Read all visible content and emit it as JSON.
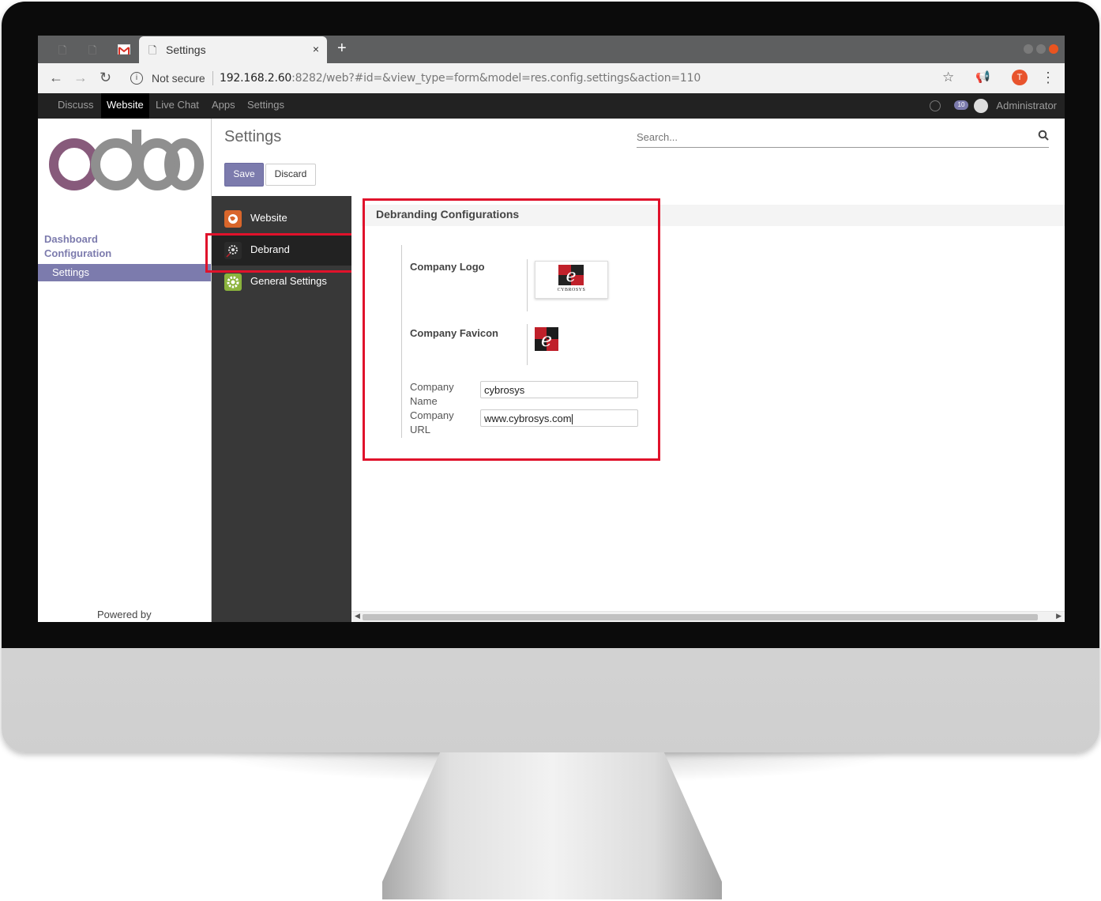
{
  "browser": {
    "tab_title": "Settings",
    "tab_close": "×",
    "new_tab": "+",
    "not_secure": "Not secure",
    "url_host": "192.168.2.60",
    "url_rest": ":8282/web?#id=&view_type=form&model=res.config.settings&action=110",
    "profile_initial": "T"
  },
  "topmenu": {
    "items": [
      "Discuss",
      "Website",
      "Live Chat",
      "Apps",
      "Settings"
    ],
    "active": "Website",
    "message_count": "10",
    "user": "Administrator"
  },
  "sidebar": {
    "logo_text": "odoo",
    "links": [
      "Dashboard",
      "Configuration"
    ],
    "active_item": "Settings",
    "powered_by": "Powered by"
  },
  "control_panel": {
    "title": "Settings",
    "search_placeholder": "Search...",
    "save_label": "Save",
    "discard_label": "Discard"
  },
  "settings_nav": {
    "items": [
      {
        "label": "Website",
        "icon": "globe-icon",
        "color": "#d9662b"
      },
      {
        "label": "Debrand",
        "icon": "debrand-gear-icon",
        "color": "#2b2b2b"
      },
      {
        "label": "General Settings",
        "icon": "gear-icon",
        "color": "#8bb33d"
      }
    ],
    "active": "Debrand"
  },
  "debrand": {
    "section_title": "Debranding Configurations",
    "company_logo_label": "Company Logo",
    "company_favicon_label": "Company Favicon",
    "company_name_label": "Company Name",
    "company_name_value": "cybrosys",
    "company_url_label": "Company URL",
    "company_url_value": "www.cybrosys.com",
    "logo_caption": "CYBROSYS"
  },
  "colors": {
    "odoo_primary": "#7c7bad",
    "highlight": "#e0122b",
    "menu_bg": "#222222",
    "nav_bg": "#383838"
  }
}
